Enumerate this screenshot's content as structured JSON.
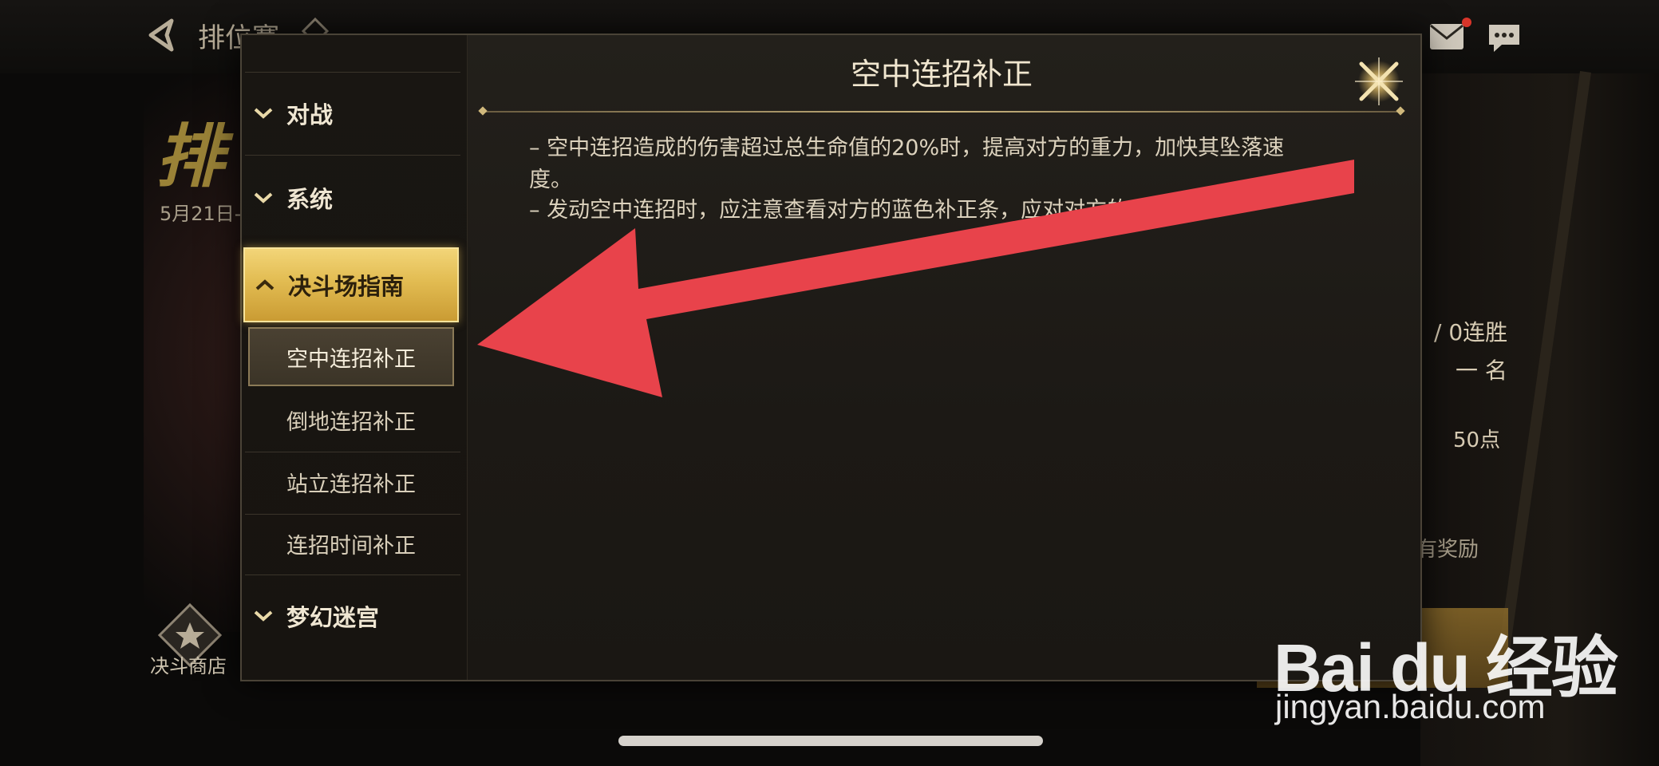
{
  "header": {
    "title": "排位赛",
    "back_icon": "back-arrow-icon",
    "mail_icon": "mail-icon",
    "chat_icon": "chat-bubble-icon"
  },
  "background": {
    "date_text": "5月21日-",
    "shop_label": "决斗商店",
    "win_streak": "/ 0连胜",
    "rank": "一 名",
    "points": "50点",
    "reward_text": "有奖励",
    "title_art": "排"
  },
  "modal": {
    "title": "空中连招补正",
    "description": [
      "– 空中连招造成的伤害超过总生命值的20%时，提高对方的重力，加快其坠落速",
      "度。",
      "– 发动空中连招时，应注意查看对方的蓝色补正条，应对对方的"
    ],
    "close_icon": "close-x-icon",
    "categories": [
      {
        "label": "对战",
        "expanded": false
      },
      {
        "label": "系统",
        "expanded": false
      },
      {
        "label": "决斗场指南",
        "expanded": true
      },
      {
        "label": "梦幻迷宫",
        "expanded": false
      }
    ],
    "guide_items": [
      {
        "label": "空中连招补正",
        "selected": true
      },
      {
        "label": "倒地连招补正",
        "selected": false
      },
      {
        "label": "站立连招补正",
        "selected": false
      },
      {
        "label": "连招时间补正",
        "selected": false
      }
    ]
  },
  "watermark": {
    "logo": "Bai du 经验",
    "url": "jingyan.baidu.com"
  },
  "colors": {
    "accent_gold": "#e2bc52",
    "annotation_red": "#e8434b",
    "panel_bg": "#1c1915"
  }
}
